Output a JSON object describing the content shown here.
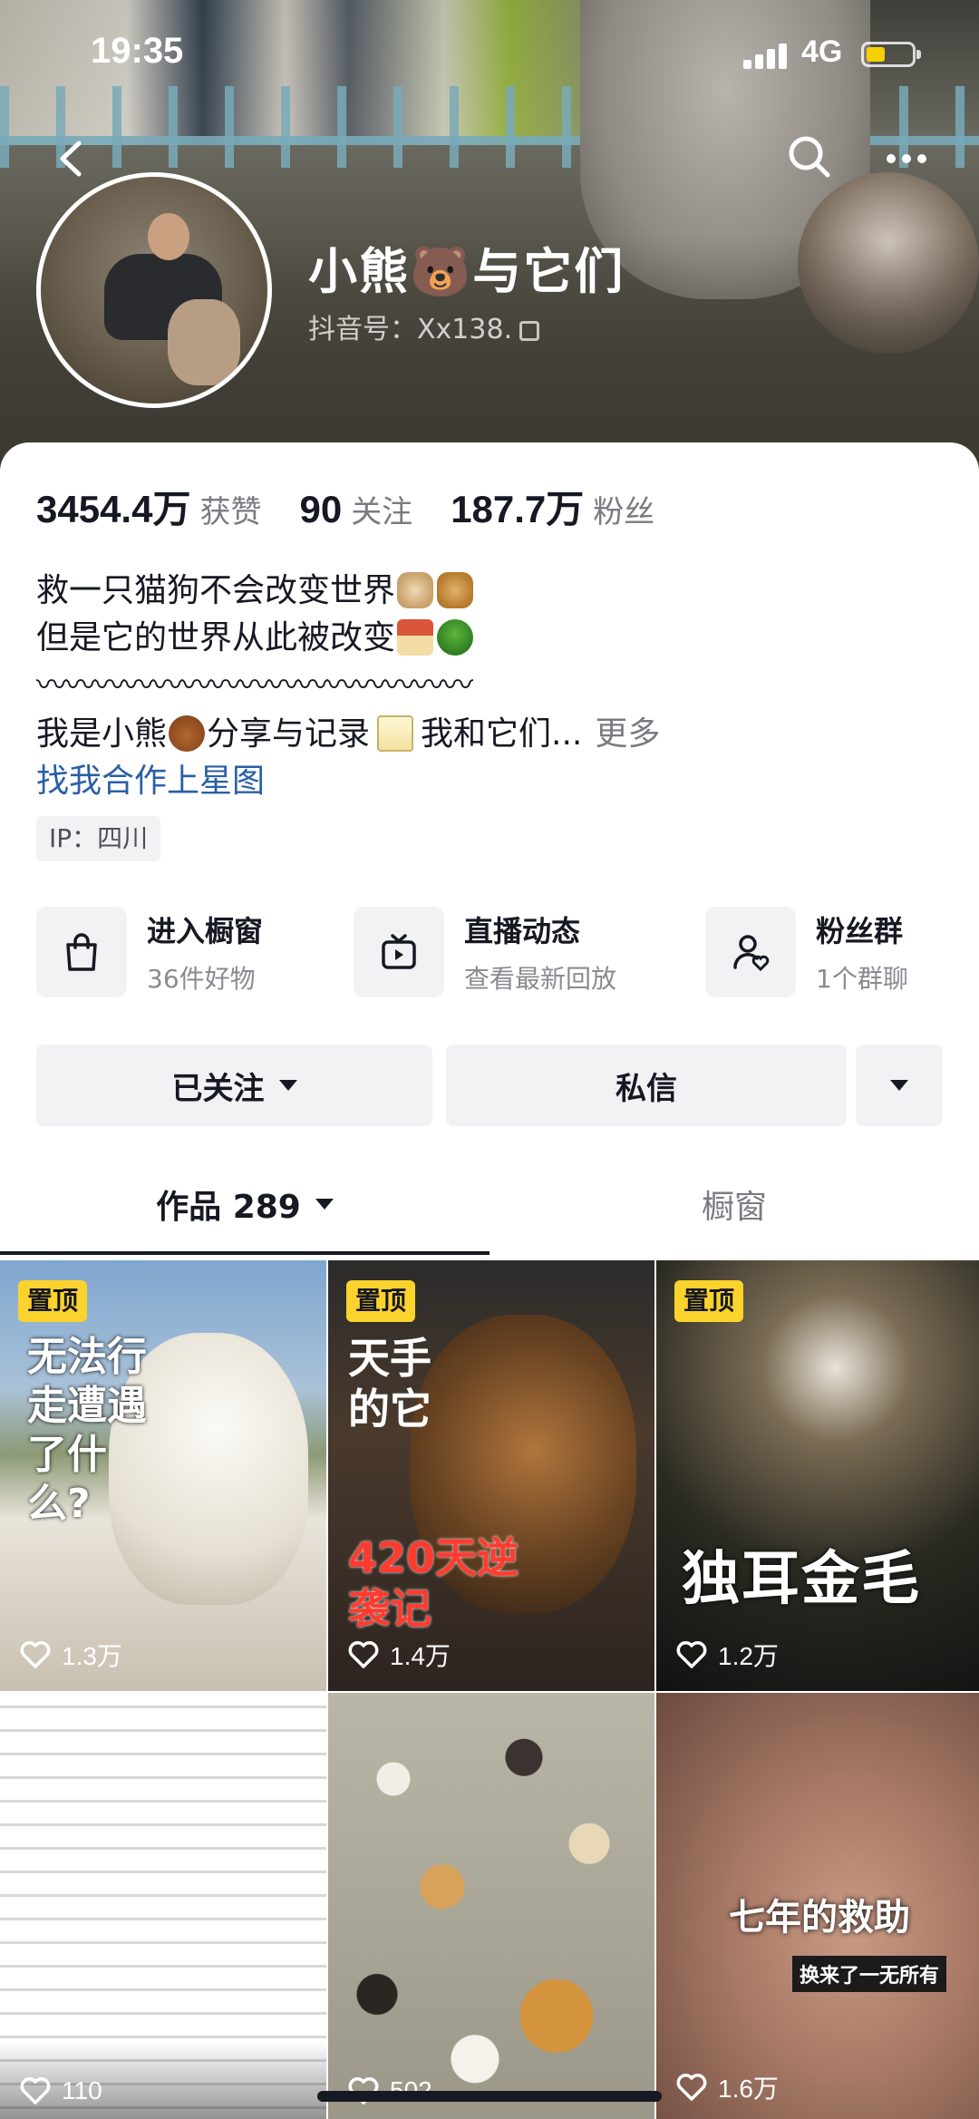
{
  "status_bar": {
    "time": "19:35",
    "network": "4G"
  },
  "profile": {
    "nickname": "小熊🐻与它们",
    "douyin_id": "抖音号：Xx138."
  },
  "stats": [
    {
      "value": "3454.4万",
      "label": "获赞"
    },
    {
      "value": "90",
      "label": "关注"
    },
    {
      "value": "187.7万",
      "label": "粉丝"
    }
  ],
  "bio": {
    "line1": "救一只猫狗不会改变世界",
    "line2": "但是它的世界从此被改变",
    "wave": "〰〰〰〰〰〰〰〰〰〰〰〰〰〰〰",
    "line4_a": "我是小熊",
    "line4_b": "分享与记录",
    "line4_c": "我和它们...",
    "more": "更多",
    "link": "找我合作上星图"
  },
  "ip": "IP：四川",
  "services": [
    {
      "title": "进入橱窗",
      "sub": "36件好物",
      "icon": "shopping-bag-icon"
    },
    {
      "title": "直播动态",
      "sub": "查看最新回放",
      "icon": "tv-icon"
    },
    {
      "title": "粉丝群",
      "sub": "1个群聊",
      "icon": "fan-group-icon"
    }
  ],
  "actions": {
    "follow": "已关注",
    "message": "私信"
  },
  "tabs": {
    "works": "作品 289",
    "shop": "橱窗"
  },
  "videos": [
    {
      "pinned": "置顶",
      "likes": "1.3万",
      "overlay": "无法行走遭遇了什么?"
    },
    {
      "pinned": "置顶",
      "likes": "1.4万",
      "overlay_a": "天手的它",
      "overlay_b": "420天逆袭记"
    },
    {
      "pinned": "置顶",
      "likes": "1.2万",
      "overlay": "独耳金毛"
    },
    {
      "likes": "110"
    },
    {
      "likes": "502"
    },
    {
      "likes": "1.6万",
      "overlay_a": "七年的救助",
      "overlay_b": "换来了一无所有"
    }
  ],
  "colors": {
    "accent_link": "#2a5fa6",
    "pin_badge": "#fcd32c",
    "button_bg": "#f2f2f4"
  }
}
